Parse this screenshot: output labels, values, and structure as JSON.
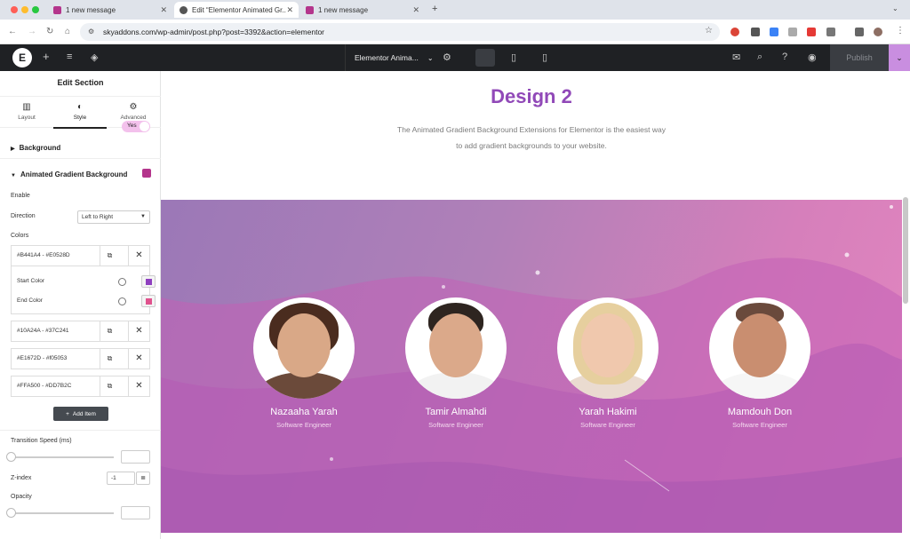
{
  "browser": {
    "tabs": [
      {
        "label": "1 new message"
      },
      {
        "label": "Edit “Elementor Animated Gr..."
      },
      {
        "label": "1 new message"
      }
    ],
    "new_tab": "+",
    "url": "skyaddons.com/wp-admin/post.php?post=3392&action=elementor"
  },
  "editor": {
    "doc_title": "Elementor Anima...",
    "publish": "Publish"
  },
  "sidebar": {
    "title": "Edit Section",
    "tabs": [
      {
        "label": "Layout"
      },
      {
        "label": "Style"
      },
      {
        "label": "Advanced"
      }
    ],
    "background_label": "Background",
    "agb_label": "Animated Gradient Background",
    "enable_label": "Enable",
    "enable_value": "Yes",
    "direction_label": "Direction",
    "direction_value": "Left to Right",
    "colors_label": "Colors",
    "color_items": [
      {
        "label": "#B441A4 - #E0528D"
      },
      {
        "label": "#10A24A - #37C241"
      },
      {
        "label": "#E1672D - #f05053"
      },
      {
        "label": "#FFA500 - #DD7B2C"
      }
    ],
    "start_color_label": "Start Color",
    "end_color_label": "End Color",
    "start_color": "#8e3fbf",
    "end_color": "#e0528d",
    "add_item": "Add Item",
    "transition_label": "Transition Speed (ms)",
    "zindex_label": "Z-index",
    "zindex_value": "-1",
    "opacity_label": "Opacity"
  },
  "canvas": {
    "title": "Design 2",
    "description_line1": "The Animated Gradient Background Extensions for Elementor is the easiest way",
    "description_line2": "to add gradient backgrounds to your website.",
    "members": [
      {
        "name": "Nazaaha Yarah",
        "role": "Software Engineer"
      },
      {
        "name": "Tamir Almahdi",
        "role": "Software Engineer"
      },
      {
        "name": "Yarah Hakimi",
        "role": "Software Engineer"
      },
      {
        "name": "Mamdouh Don",
        "role": "Software Engineer"
      }
    ]
  },
  "colors": {
    "accent": "#9149b8",
    "topbar": "#1f2124"
  }
}
